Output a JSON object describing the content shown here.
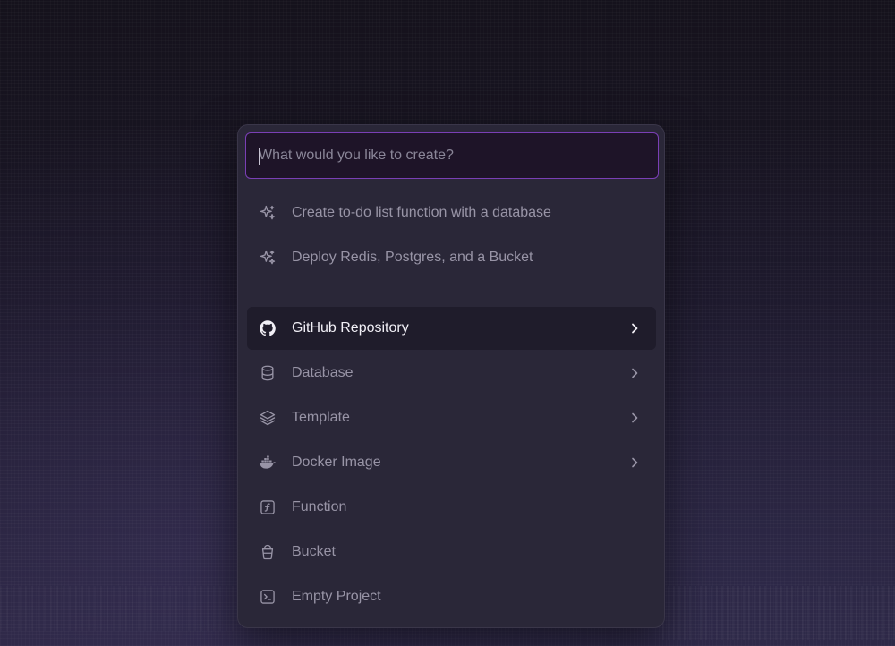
{
  "search": {
    "placeholder": "What would you like to create?",
    "value": ""
  },
  "suggestions": [
    {
      "label": "Create to-do list function with a database",
      "icon": "sparkles-icon"
    },
    {
      "label": "Deploy Redis, Postgres, and a Bucket",
      "icon": "sparkles-icon"
    }
  ],
  "options": [
    {
      "label": "GitHub Repository",
      "icon": "github-icon",
      "has_submenu": true,
      "active": true
    },
    {
      "label": "Database",
      "icon": "database-icon",
      "has_submenu": true
    },
    {
      "label": "Template",
      "icon": "layers-icon",
      "has_submenu": true
    },
    {
      "label": "Docker Image",
      "icon": "docker-icon",
      "has_submenu": true
    },
    {
      "label": "Function",
      "icon": "function-icon",
      "has_submenu": false
    },
    {
      "label": "Bucket",
      "icon": "bucket-icon",
      "has_submenu": false
    },
    {
      "label": "Empty Project",
      "icon": "terminal-icon",
      "has_submenu": false
    }
  ],
  "colors": {
    "accent_border": "#7a3fb5",
    "panel_bg": "#2a2738",
    "active_row_bg": "#1f1c2b",
    "muted_text": "#9894a6",
    "active_text": "#f1eff6"
  }
}
